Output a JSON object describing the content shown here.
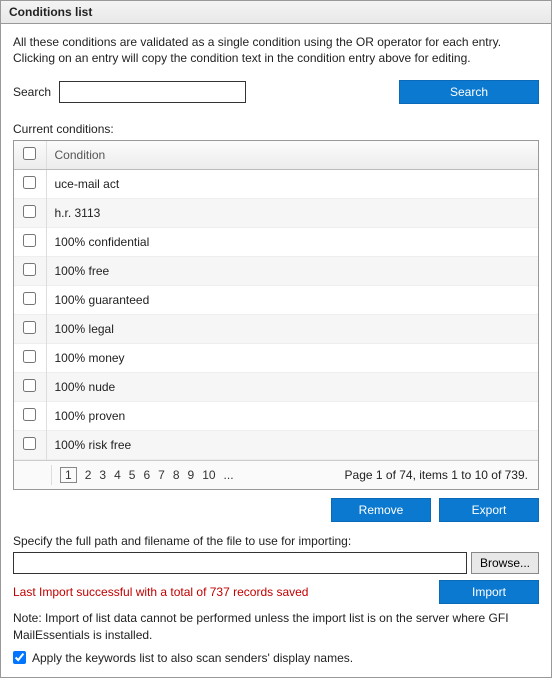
{
  "title": "Conditions list",
  "intro": "All these conditions are validated as a single condition using the OR operator for each entry. Clicking on an entry will copy the condition text in the condition entry above for editing.",
  "search": {
    "label": "Search",
    "value": "",
    "button": "Search"
  },
  "conditions": {
    "label": "Current conditions:",
    "header": "Condition",
    "rows": [
      "uce-mail act",
      "h.r. 3113",
      "100% confidential",
      "100% free",
      "100% guaranteed",
      "100% legal",
      "100% money",
      "100% nude",
      "100% proven",
      "100% risk free"
    ],
    "pager": {
      "pages": [
        "1",
        "2",
        "3",
        "4",
        "5",
        "6",
        "7",
        "8",
        "9",
        "10",
        "..."
      ],
      "info": "Page 1 of 74, items 1 to 10 of 739."
    }
  },
  "actions": {
    "remove": "Remove",
    "export": "Export"
  },
  "import": {
    "label": "Specify the full path and filename of the file to use for importing:",
    "value": "",
    "browse": "Browse...",
    "status": "Last Import successful with a total of 737 records saved",
    "button": "Import"
  },
  "note": "Note: Import of list data cannot be performed unless the import list is on the server where GFI MailEssentials is installed.",
  "apply": {
    "checked": true,
    "label": "Apply the keywords list to also scan senders' display names."
  }
}
